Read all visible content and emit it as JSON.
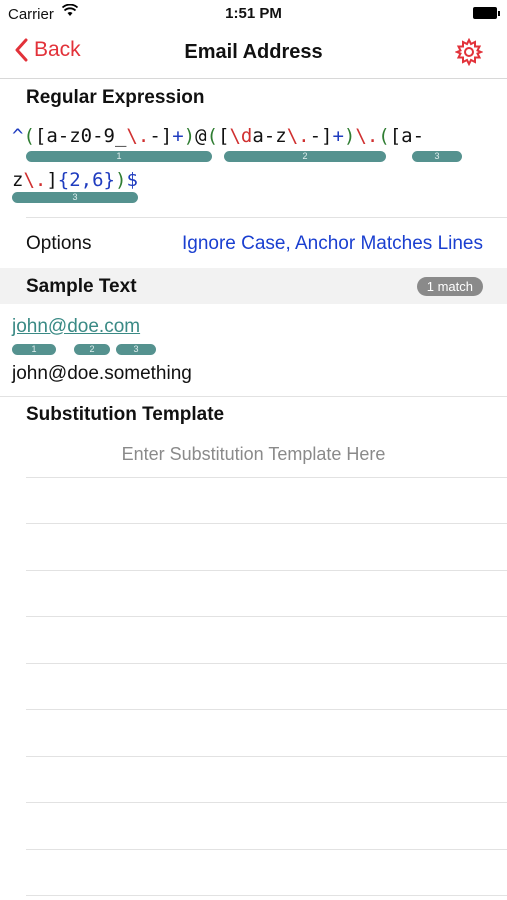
{
  "status": {
    "carrier": "Carrier",
    "time": "1:51 PM"
  },
  "nav": {
    "back_label": "Back",
    "title": "Email Address",
    "settings_icon": "gear-icon",
    "accent": "#e2323a"
  },
  "regex": {
    "heading": "Regular Expression",
    "line1_tokens": [
      {
        "t": "^",
        "c": "b"
      },
      {
        "t": "(",
        "c": "g"
      },
      {
        "t": "[a-z0-9_",
        "c": "k"
      },
      {
        "t": "\\.",
        "c": "r"
      },
      {
        "t": "-]",
        "c": "k"
      },
      {
        "t": "+",
        "c": "b"
      },
      {
        "t": ")",
        "c": "g"
      },
      {
        "t": "@",
        "c": "k"
      },
      {
        "t": "(",
        "c": "g"
      },
      {
        "t": "[",
        "c": "k"
      },
      {
        "t": "\\d",
        "c": "r"
      },
      {
        "t": "a-z",
        "c": "k"
      },
      {
        "t": "\\.",
        "c": "r"
      },
      {
        "t": "-]",
        "c": "k"
      },
      {
        "t": "+",
        "c": "b"
      },
      {
        "t": ")",
        "c": "g"
      },
      {
        "t": "\\.",
        "c": "r"
      },
      {
        "t": "(",
        "c": "g"
      },
      {
        "t": "[a-",
        "c": "k"
      }
    ],
    "line2_tokens": [
      {
        "t": "z",
        "c": "k"
      },
      {
        "t": "\\.",
        "c": "r"
      },
      {
        "t": "]",
        "c": "k"
      },
      {
        "t": "{2,6}",
        "c": "b"
      },
      {
        "t": ")",
        "c": "g"
      },
      {
        "t": "$",
        "c": "b"
      }
    ],
    "groups_line1": [
      "1",
      "2",
      "3"
    ],
    "groups_line2": [
      "3"
    ]
  },
  "options": {
    "label": "Options",
    "value": "Ignore Case, Anchor Matches Lines"
  },
  "sample": {
    "heading": "Sample Text",
    "badge": "1 match",
    "lines": [
      "john@doe.com",
      "john@doe.something"
    ],
    "match_groups": [
      "1",
      "2",
      "3"
    ]
  },
  "substitution": {
    "heading": "Substitution Template",
    "placeholder": "Enter Substitution Template Here"
  }
}
